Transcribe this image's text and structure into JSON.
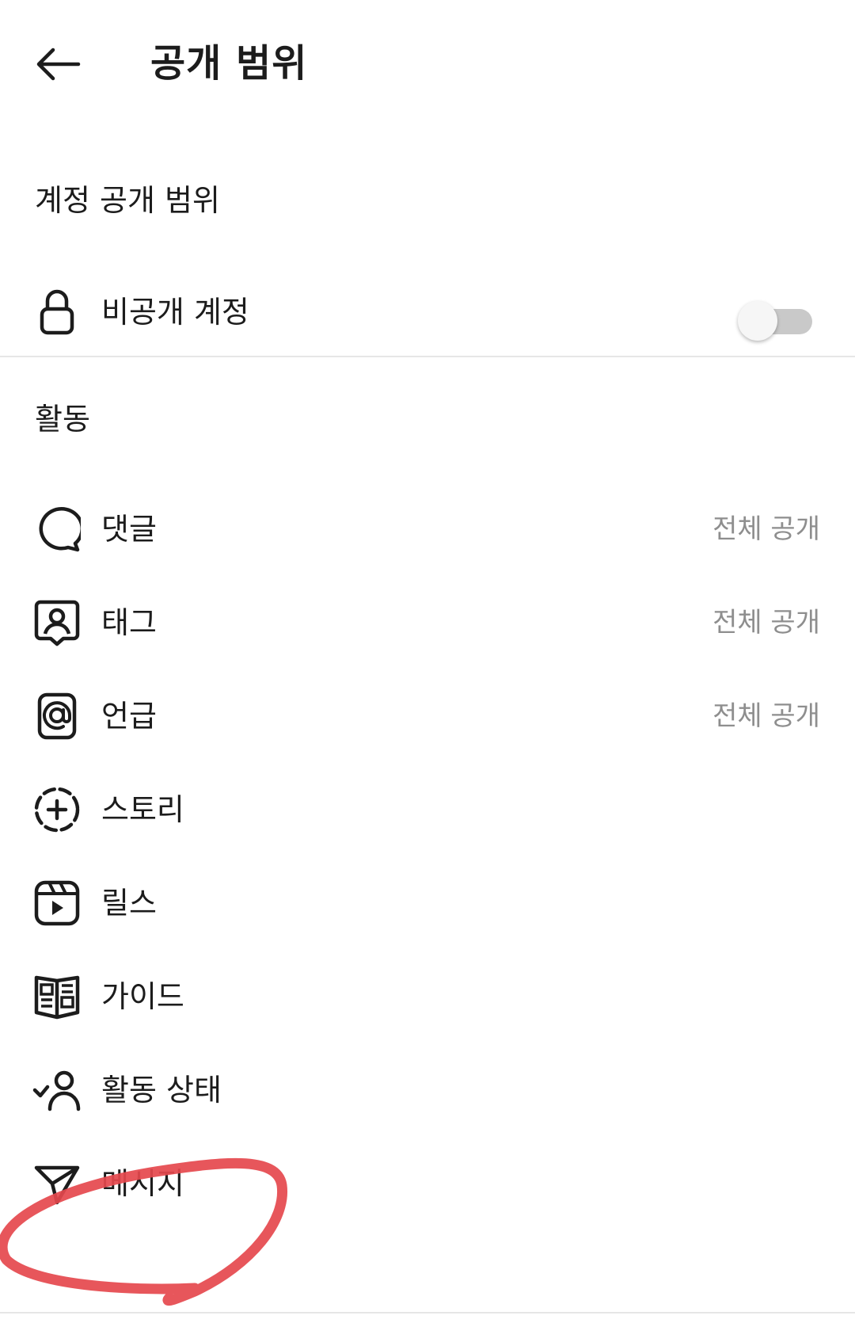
{
  "header": {
    "title": "공개 범위",
    "back_icon": "arrow-left-icon"
  },
  "account_section": {
    "heading": "계정 공개 범위",
    "private_account": {
      "label": "비공개 계정",
      "icon": "lock-icon",
      "enabled": false
    }
  },
  "activity_section": {
    "heading": "활동",
    "items": [
      {
        "label": "댓글",
        "value": "전체 공개",
        "icon": "comment-bubble-icon"
      },
      {
        "label": "태그",
        "value": "전체 공개",
        "icon": "person-tag-icon"
      },
      {
        "label": "언급",
        "value": "전체 공개",
        "icon": "at-sign-icon"
      },
      {
        "label": "스토리",
        "icon": "story-add-icon"
      },
      {
        "label": "릴스",
        "icon": "reels-icon"
      },
      {
        "label": "가이드",
        "icon": "guide-book-icon"
      },
      {
        "label": "활동 상태",
        "icon": "activity-status-icon"
      },
      {
        "label": "메시지",
        "icon": "send-paper-plane-icon"
      }
    ]
  },
  "colors": {
    "annotation": "#e5484d",
    "secondary_text": "#8e8e8e",
    "divider": "#e6e6e6"
  }
}
